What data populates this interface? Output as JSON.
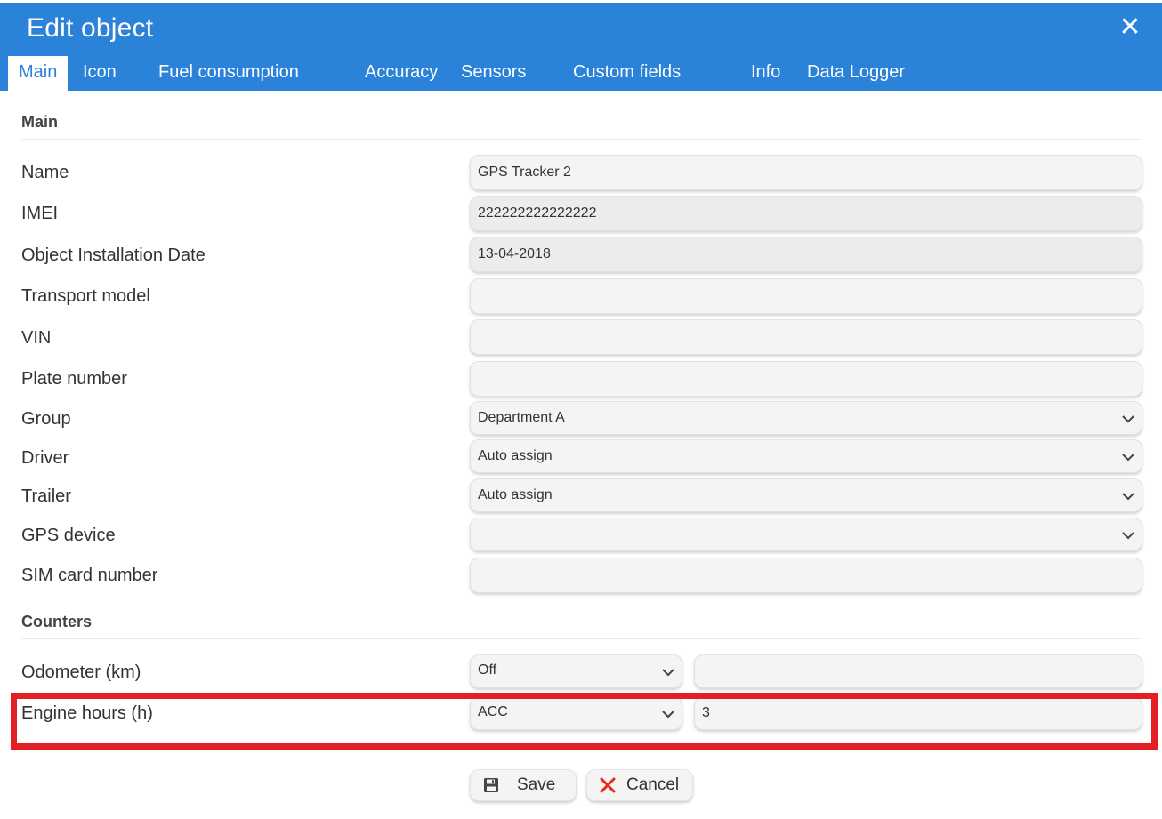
{
  "dialog": {
    "title": "Edit object",
    "close_glyph": "✕"
  },
  "tabs": [
    {
      "label": "Main",
      "active": true
    },
    {
      "label": "Icon"
    },
    {
      "label": "Fuel consumption"
    },
    {
      "label": "Accuracy"
    },
    {
      "label": "Sensors"
    },
    {
      "label": "Custom fields"
    },
    {
      "label": "Info"
    },
    {
      "label": "Data Logger"
    }
  ],
  "main_section": {
    "title": "Main",
    "fields": {
      "name": {
        "label": "Name",
        "value": "GPS Tracker 2"
      },
      "imei": {
        "label": "IMEI",
        "value": "222222222222222"
      },
      "install_date": {
        "label": "Object Installation Date",
        "value": "13-04-2018"
      },
      "transport_model": {
        "label": "Transport model",
        "value": ""
      },
      "vin": {
        "label": "VIN",
        "value": ""
      },
      "plate_number": {
        "label": "Plate number",
        "value": ""
      },
      "group": {
        "label": "Group",
        "value": "Department A"
      },
      "driver": {
        "label": "Driver",
        "value": "Auto assign"
      },
      "trailer": {
        "label": "Trailer",
        "value": "Auto assign"
      },
      "gps_device": {
        "label": "GPS device",
        "value": ""
      },
      "sim_card": {
        "label": "SIM card number",
        "value": ""
      }
    }
  },
  "counters_section": {
    "title": "Counters",
    "odometer": {
      "label": "Odometer (km)",
      "mode": "Off",
      "value": ""
    },
    "engine_hours": {
      "label": "Engine hours (h)",
      "mode": "ACC",
      "value": "3"
    }
  },
  "buttons": {
    "save": "Save",
    "cancel": "Cancel"
  },
  "colors": {
    "header": "#2b82d9",
    "highlight": "#e31e24",
    "cancel_icon": "#e32c1e"
  },
  "icons": {
    "close": "close-icon",
    "chevron": "chevron-down-icon",
    "save": "floppy-disk-icon",
    "cancel": "x-icon"
  }
}
